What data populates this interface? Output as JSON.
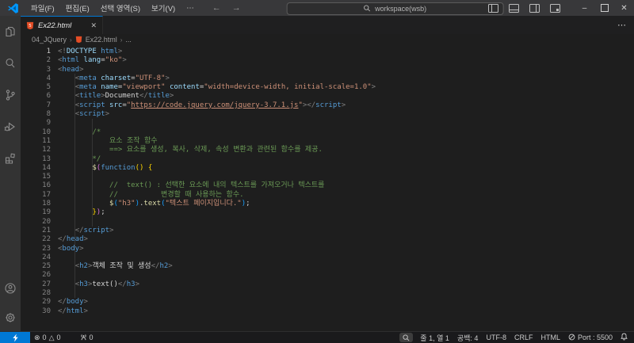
{
  "titlebar": {
    "menus": [
      "파일(F)",
      "편집(E)",
      "선택 영역(S)",
      "보기(V)",
      "⋯"
    ],
    "nav_back": "←",
    "nav_forward": "→",
    "command_center": "workspace(wsb)",
    "window": {
      "minimize": "–",
      "close": "✕"
    }
  },
  "tabs": {
    "active_label": "Ex22.html",
    "close": "✕",
    "more_actions": "⋯"
  },
  "breadcrumb": {
    "folder": "04_JQuery",
    "file": "Ex22.html",
    "tail": "...",
    "separator": "›"
  },
  "editor": {
    "lines": [
      {
        "n": 1,
        "t": [
          [
            "p",
            "<!"
          ],
          [
            "a",
            "DOCTYPE"
          ],
          [
            "w",
            " "
          ],
          [
            "t",
            "html"
          ],
          [
            "p",
            ">"
          ]
        ]
      },
      {
        "n": 2,
        "t": [
          [
            "p",
            "<"
          ],
          [
            "t",
            "html"
          ],
          [
            "w",
            " "
          ],
          [
            "a",
            "lang"
          ],
          [
            "w",
            "="
          ],
          [
            "s",
            "\"ko\""
          ],
          [
            "p",
            ">"
          ]
        ]
      },
      {
        "n": 3,
        "t": [
          [
            "p",
            "<"
          ],
          [
            "t",
            "head"
          ],
          [
            "p",
            ">"
          ]
        ]
      },
      {
        "n": 4,
        "t": [
          [
            "w",
            "    "
          ],
          [
            "p",
            "<"
          ],
          [
            "t",
            "meta"
          ],
          [
            "w",
            " "
          ],
          [
            "a",
            "charset"
          ],
          [
            "w",
            "="
          ],
          [
            "s",
            "\"UTF-8\""
          ],
          [
            "p",
            ">"
          ]
        ]
      },
      {
        "n": 5,
        "t": [
          [
            "w",
            "    "
          ],
          [
            "p",
            "<"
          ],
          [
            "t",
            "meta"
          ],
          [
            "w",
            " "
          ],
          [
            "a",
            "name"
          ],
          [
            "w",
            "="
          ],
          [
            "s",
            "\"viewport\""
          ],
          [
            "w",
            " "
          ],
          [
            "a",
            "content"
          ],
          [
            "w",
            "="
          ],
          [
            "s",
            "\"width=device-width, initial-scale=1.0\""
          ],
          [
            "p",
            ">"
          ]
        ]
      },
      {
        "n": 6,
        "t": [
          [
            "w",
            "    "
          ],
          [
            "p",
            "<"
          ],
          [
            "t",
            "title"
          ],
          [
            "p",
            ">"
          ],
          [
            "w",
            "Document"
          ],
          [
            "p",
            "</"
          ],
          [
            "t",
            "title"
          ],
          [
            "p",
            ">"
          ]
        ]
      },
      {
        "n": 7,
        "t": [
          [
            "w",
            "    "
          ],
          [
            "p",
            "<"
          ],
          [
            "t",
            "script"
          ],
          [
            "w",
            " "
          ],
          [
            "a",
            "src"
          ],
          [
            "w",
            "="
          ],
          [
            "s",
            "\""
          ],
          [
            "sl",
            "https://code.jquery.com/jquery-3.7.1.js"
          ],
          [
            "s",
            "\""
          ],
          [
            "p",
            ">"
          ],
          [
            "p",
            "</"
          ],
          [
            "t",
            "script"
          ],
          [
            "p",
            ">"
          ]
        ]
      },
      {
        "n": 8,
        "t": [
          [
            "w",
            "    "
          ],
          [
            "p",
            "<"
          ],
          [
            "t",
            "script"
          ],
          [
            "p",
            ">"
          ]
        ]
      },
      {
        "n": 9,
        "t": []
      },
      {
        "n": 10,
        "t": [
          [
            "w",
            "        "
          ],
          [
            "c",
            "/*"
          ]
        ]
      },
      {
        "n": 11,
        "t": [
          [
            "w",
            "            "
          ],
          [
            "c",
            "요소 조작 함수"
          ]
        ]
      },
      {
        "n": 12,
        "t": [
          [
            "w",
            "            "
          ],
          [
            "c",
            "==> 요소를 생성, 복사, 삭제, 속성 변환과 관련된 함수를 제공."
          ]
        ]
      },
      {
        "n": 13,
        "t": [
          [
            "w",
            "        "
          ],
          [
            "c",
            "*/"
          ]
        ]
      },
      {
        "n": 14,
        "t": [
          [
            "w",
            "        "
          ],
          [
            "f",
            "$"
          ],
          [
            "g2",
            "("
          ],
          [
            "k",
            "function"
          ],
          [
            "g1",
            "()"
          ],
          [
            "w",
            " "
          ],
          [
            "g1",
            "{"
          ]
        ]
      },
      {
        "n": 15,
        "t": []
      },
      {
        "n": 16,
        "t": [
          [
            "w",
            "            "
          ],
          [
            "c",
            "//  text() : 선택한 요소에 내의 텍스트를 가져오거나 텍스트를"
          ]
        ]
      },
      {
        "n": 17,
        "t": [
          [
            "w",
            "            "
          ],
          [
            "c",
            "//          변경할 때 사용하는 함수."
          ]
        ]
      },
      {
        "n": 18,
        "t": [
          [
            "w",
            "            "
          ],
          [
            "f",
            "$"
          ],
          [
            "g3",
            "("
          ],
          [
            "s",
            "\"h3\""
          ],
          [
            "g3",
            ")"
          ],
          [
            "w",
            "."
          ],
          [
            "f",
            "text"
          ],
          [
            "g3",
            "("
          ],
          [
            "s",
            "\"텍스트 페이지입니다.\""
          ],
          [
            "g3",
            ")"
          ],
          [
            "w",
            ";"
          ]
        ]
      },
      {
        "n": 19,
        "t": [
          [
            "w",
            "        "
          ],
          [
            "g1",
            "}"
          ],
          [
            "g2",
            ")"
          ],
          [
            "w",
            ";"
          ]
        ]
      },
      {
        "n": 20,
        "t": []
      },
      {
        "n": 21,
        "t": [
          [
            "w",
            "    "
          ],
          [
            "p",
            "</"
          ],
          [
            "t",
            "script"
          ],
          [
            "p",
            ">"
          ]
        ]
      },
      {
        "n": 22,
        "t": [
          [
            "p",
            "</"
          ],
          [
            "t",
            "head"
          ],
          [
            "p",
            ">"
          ]
        ]
      },
      {
        "n": 23,
        "t": [
          [
            "p",
            "<"
          ],
          [
            "t",
            "body"
          ],
          [
            "p",
            ">"
          ]
        ]
      },
      {
        "n": 24,
        "t": []
      },
      {
        "n": 25,
        "t": [
          [
            "w",
            "    "
          ],
          [
            "p",
            "<"
          ],
          [
            "t",
            "h2"
          ],
          [
            "p",
            ">"
          ],
          [
            "w",
            "객체 조작 및 생성"
          ],
          [
            "p",
            "</"
          ],
          [
            "t",
            "h2"
          ],
          [
            "p",
            ">"
          ]
        ]
      },
      {
        "n": 26,
        "t": []
      },
      {
        "n": 27,
        "t": [
          [
            "w",
            "    "
          ],
          [
            "p",
            "<"
          ],
          [
            "t",
            "h3"
          ],
          [
            "p",
            ">"
          ],
          [
            "w",
            "text()"
          ],
          [
            "p",
            "</"
          ],
          [
            "t",
            "h3"
          ],
          [
            "p",
            ">"
          ]
        ]
      },
      {
        "n": 28,
        "t": []
      },
      {
        "n": 29,
        "t": [
          [
            "p",
            "</"
          ],
          [
            "t",
            "body"
          ],
          [
            "p",
            ">"
          ]
        ]
      },
      {
        "n": 30,
        "t": [
          [
            "p",
            "</"
          ],
          [
            "t",
            "html"
          ],
          [
            "p",
            ">"
          ]
        ]
      }
    ]
  },
  "status": {
    "errors_icon": "⊗",
    "errors": "0",
    "warnings_icon": "△",
    "warnings": "0",
    "ports_count": "0",
    "line_col": "줄 1, 열 1",
    "spaces": "공백: 4",
    "encoding": "UTF-8",
    "eol": "CRLF",
    "language": "HTML",
    "port": "Port : 5500"
  },
  "colors": {
    "accent": "#0078d4",
    "html_icon_orange": "#e44d26",
    "comment_green": "#6a9955",
    "string_orange": "#ce9178",
    "tag_blue": "#569cd6"
  }
}
